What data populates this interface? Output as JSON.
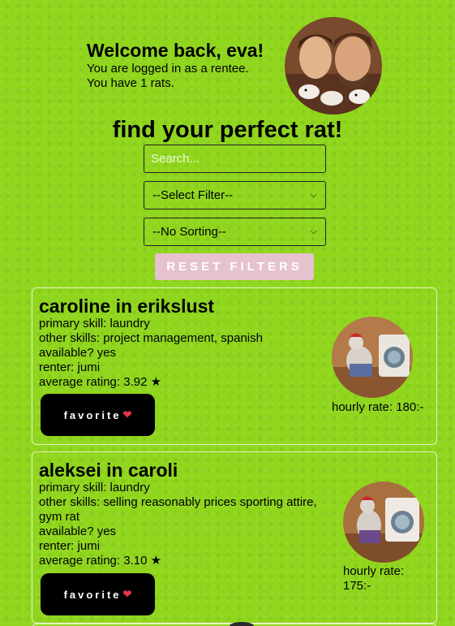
{
  "welcome": {
    "title": "Welcome back, eva!",
    "logged_in": "You are logged in as a rentee.",
    "rats_count": "You have 1 rats."
  },
  "heading": "find your perfect rat!",
  "search": {
    "placeholder": "Search..."
  },
  "filter_select": {
    "selected": "--Select Filter--"
  },
  "sort_select": {
    "selected": "--No Sorting--"
  },
  "reset_label": "RESET FILTERS",
  "cards": [
    {
      "title": "caroline in erikslust",
      "primary": "primary skill: laundry",
      "other": "other skills: project management, spanish",
      "available": "available? yes",
      "renter": "renter: jumi",
      "rating": "average rating: 3.92 ★",
      "favorite": "favorite",
      "rate": "hourly rate: 180:-"
    },
    {
      "title": "aleksei in caroli",
      "primary": "primary skill: laundry",
      "other": "other skills: selling reasonably prices sporting attire, gym rat",
      "available": "available? yes",
      "renter": "renter: jumi",
      "rating": "average rating: 3.10 ★",
      "favorite": "favorite",
      "rate": "hourly rate: 175:-"
    }
  ],
  "icons": {
    "heart": "heart-icon",
    "chevron": "chevron-down-icon"
  },
  "colors": {
    "background": "#8fd61c",
    "reset_button": "#e6c2cf",
    "favorite_button": "#000000"
  }
}
